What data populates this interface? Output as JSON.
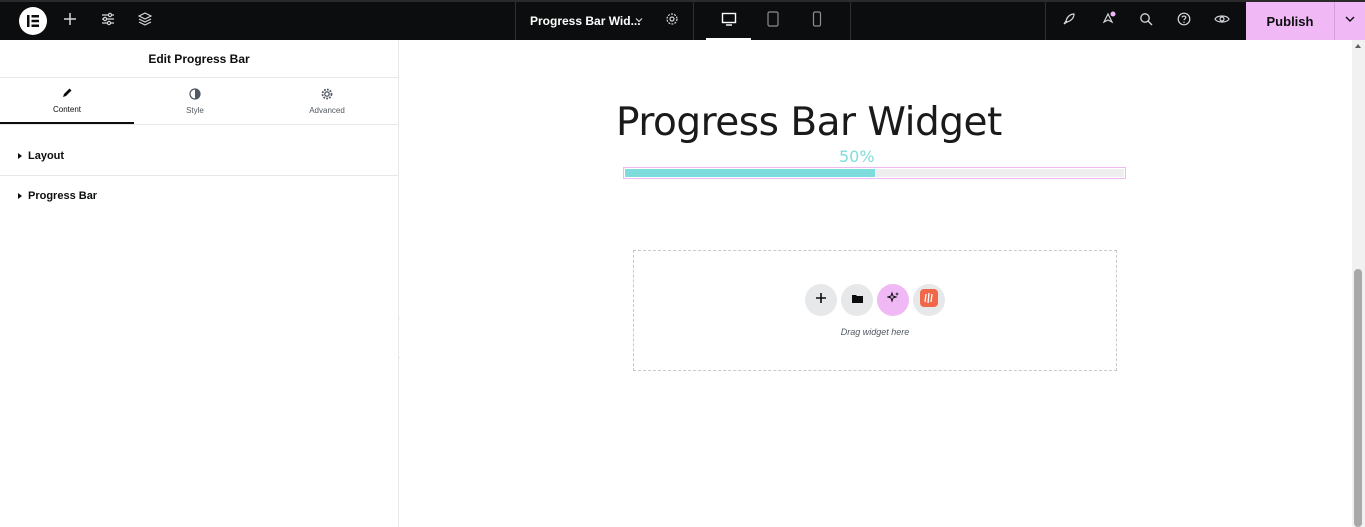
{
  "topbar": {
    "document_title": "Progress Bar Wid...",
    "publish_label": "Publish",
    "icons": [
      "elementor-logo-icon",
      "plus-icon",
      "sliders-icon",
      "layers-icon",
      "chevron-down-icon",
      "gear-icon",
      "desktop-icon",
      "tablet-icon",
      "mobile-icon",
      "rocket-icon",
      "notification-icon",
      "search-icon",
      "help-icon",
      "eye-icon"
    ]
  },
  "panel": {
    "title": "Edit Progress Bar",
    "tabs": [
      {
        "label": "Content",
        "icon": "pencil-icon",
        "active": true
      },
      {
        "label": "Style",
        "icon": "contrast-icon",
        "active": false
      },
      {
        "label": "Advanced",
        "icon": "gear-icon",
        "active": false
      }
    ],
    "sections": [
      {
        "label": "Layout"
      },
      {
        "label": "Progress Bar"
      }
    ]
  },
  "canvas": {
    "heading": "Progress Bar Widget",
    "progress": {
      "label": "50%",
      "value": 50,
      "fill_color": "#7fdcdc",
      "outline_color": "#f0b8f5"
    },
    "dropzone": {
      "text": "Drag widget here",
      "buttons": [
        "add-section-icon",
        "template-library-icon",
        "ai-sparkle-icon",
        "addon-icon"
      ]
    }
  },
  "colors": {
    "topbar_bg": "#0c0d0e",
    "accent": "#f0b8f5",
    "progress_fill": "#7fdcdc"
  }
}
